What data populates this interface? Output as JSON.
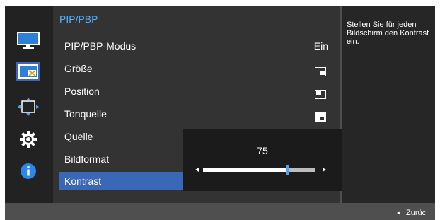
{
  "menu": {
    "title": "PIP/PBP",
    "items": [
      {
        "label": "PIP/PBP-Modus",
        "value": "Ein",
        "icon": null
      },
      {
        "label": "Größe",
        "value": null,
        "icon": "size-icon"
      },
      {
        "label": "Position",
        "value": null,
        "icon": "position-icon"
      },
      {
        "label": "Tonquelle",
        "value": null,
        "icon": "sound-source-icon"
      },
      {
        "label": "Quelle",
        "value": null,
        "icon": null
      },
      {
        "label": "Bildformat",
        "value": null,
        "icon": null
      },
      {
        "label": "Kontrast",
        "value": null,
        "icon": null,
        "selected": true
      }
    ]
  },
  "sidebar": {
    "icons": [
      "monitor-icon",
      "pip-icon",
      "move-arrows-icon",
      "gear-icon",
      "info-icon"
    ]
  },
  "slider": {
    "value": "75",
    "level_percent": 75,
    "left_arrow_icon": "left-arrow-icon",
    "right_arrow_icon": "right-arrow-icon"
  },
  "help": {
    "text": "Stellen Sie für jeden Bildschirm den Kontrast ein."
  },
  "footer": {
    "back_label": "Zurüc"
  },
  "colors": {
    "title_blue": "#52b1ff",
    "selection_blue": "#3a68b6",
    "thumb_blue": "#4ea3f0"
  }
}
